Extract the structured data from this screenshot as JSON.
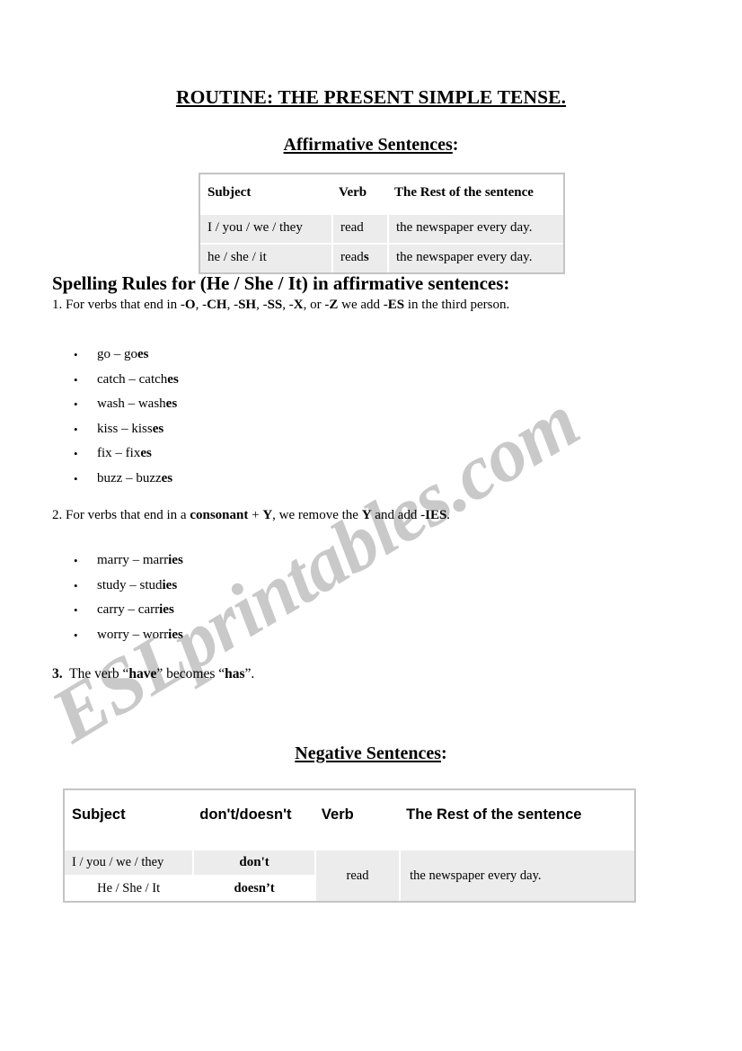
{
  "watermark": {
    "text": "ESLprintables.com",
    "color": "#c9c9c9"
  },
  "document": {
    "title_main": "ROUTINE:  THE PRESENT SIMPLE TENSE.",
    "affirmative_heading": "Affirmative Sentences",
    "affirmative_heading_colon": ":",
    "negative_heading": "Negative Sentences",
    "negative_heading_colon": ":"
  },
  "affirmative_table": {
    "headers": [
      "Subject",
      "Verb",
      "The Rest of the sentence"
    ],
    "rows": [
      {
        "subject": "I / you / we / they",
        "verb_stem": "read",
        "verb_suffix": "",
        "rest": "the newspaper every day."
      },
      {
        "subject": "he / she / it",
        "verb_stem": "read",
        "verb_suffix": "s",
        "rest": "the newspaper every day."
      }
    ]
  },
  "spelling_rules": {
    "heading": "Spelling Rules for (He / She / It) in affirmative sentences:",
    "rule1": {
      "part1": "1. For verbs that end in -",
      "b1": "O",
      "part2": ", -",
      "b2": "CH",
      "part3": ", -",
      "b3": "SH",
      "part4": ", -",
      "b4": "SS",
      "part5": ", -",
      "b5": "X",
      "part6": ", or -",
      "b6": "Z",
      "part7": " we add -",
      "b7": "ES",
      "part8": " in the third person."
    },
    "rule1_examples": [
      {
        "stem": "go – go",
        "suffix": "es"
      },
      {
        "stem": "catch – catch",
        "suffix": "es"
      },
      {
        "stem": "wash – wash",
        "suffix": "es"
      },
      {
        "stem": "kiss – kiss",
        "suffix": "es"
      },
      {
        "stem": "fix – fix",
        "suffix": "es"
      },
      {
        "stem": "buzz – buzz",
        "suffix": "es"
      }
    ],
    "rule2": {
      "part1": "2. For verbs that end in a ",
      "b1": "consonant",
      "part2": " + ",
      "b2": "Y",
      "part3": ", we remove the ",
      "b3": "Y",
      "part4": " and add -",
      "b4": "IES",
      "part5": "."
    },
    "rule2_examples": [
      {
        "stem": "marry – marr",
        "suffix": "ies"
      },
      {
        "stem": "study – stud",
        "suffix": "ies"
      },
      {
        "stem": "carry – carr",
        "suffix": "ies"
      },
      {
        "stem": "worry – worr",
        "suffix": "ies"
      }
    ],
    "rule3": {
      "num": "3.",
      "part1": "  The  verb  “",
      "b1": "have",
      "part2": "”  becomes  “",
      "b2": "has",
      "part3": "”."
    }
  },
  "negative_table": {
    "headers": [
      "Subject",
      "don't/doesn't",
      "Verb",
      "The Rest of the sentence"
    ],
    "rows": [
      {
        "subject": "I / you / we / they",
        "aux": "don't"
      },
      {
        "subject": "He / She / It",
        "aux": "doesn’t"
      }
    ],
    "verb": "read",
    "rest": "the newspaper every day."
  }
}
